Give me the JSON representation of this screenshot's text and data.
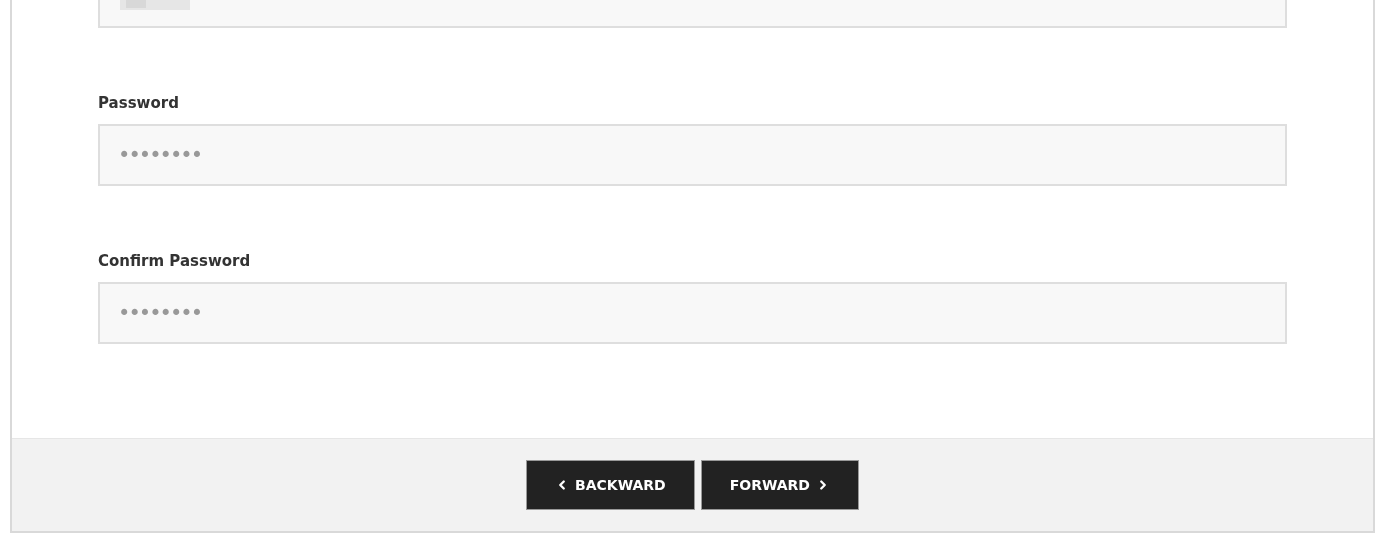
{
  "fields": [
    {
      "kind": "redacted"
    },
    {
      "kind": "password",
      "label": "Password",
      "value": "••••••••"
    },
    {
      "kind": "password",
      "label": "Confirm Password",
      "value": "••••••••"
    }
  ],
  "buttons": [
    {
      "label": "BACKWARD",
      "kind": "back"
    },
    {
      "label": "FORWARD",
      "kind": "next"
    }
  ]
}
